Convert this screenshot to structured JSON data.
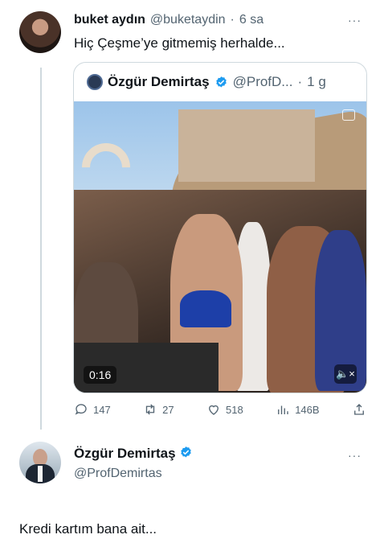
{
  "tweet": {
    "author_name": "buket aydın",
    "handle": "@buketaydin",
    "separator": "·",
    "time": "6 sa",
    "text": "Hiç Çeşme’ye gitmemiş herhalde...",
    "more_icon": "···"
  },
  "quote": {
    "author_name": "Özgür Demirtaş",
    "handle": "@ProfD...",
    "separator": "·",
    "time": "1 g",
    "verified_icon": "verified-badge",
    "video": {
      "duration": "0:16",
      "mute_icon": "🔈×"
    }
  },
  "actions": {
    "replies": "147",
    "retweets": "27",
    "likes": "518",
    "views": "146B"
  },
  "reply": {
    "author_name": "Özgür Demirtaş",
    "handle": "@ProfDemirtas",
    "text": "Kredi kartım bana ait...",
    "more_icon": "···"
  },
  "colors": {
    "text": "#0f1419",
    "muted": "#536471",
    "verified": "#1d9bf0",
    "border": "#cfd9de"
  }
}
